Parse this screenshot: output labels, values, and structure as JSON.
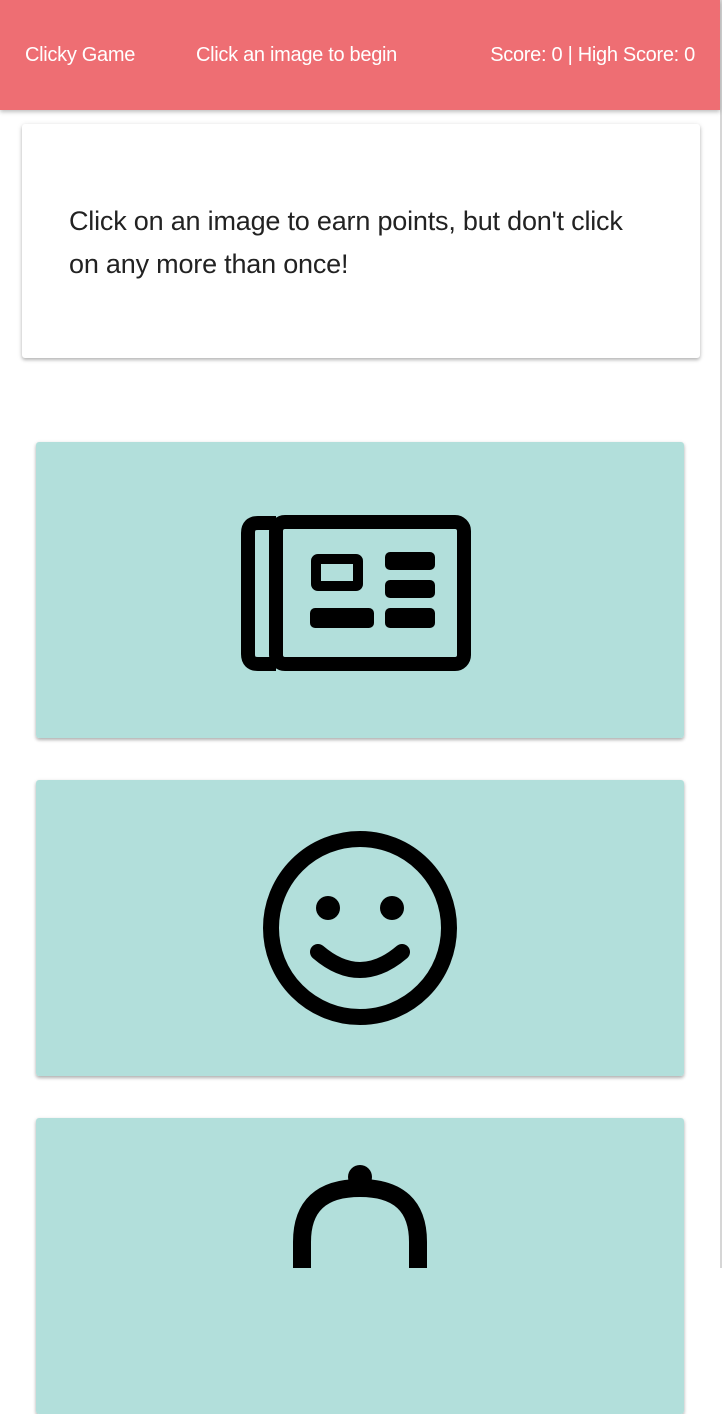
{
  "navbar": {
    "brand": "Clicky Game",
    "status": "Click an image to begin",
    "score": "Score: 0 | High Score: 0"
  },
  "intro": {
    "text": "Click on an image to earn points, but don't click on any more than once!"
  },
  "colors": {
    "navbar": "#ee6e73",
    "tile": "#b2dfdb",
    "icon": "#000000"
  },
  "tiles": [
    {
      "icon": "newspaper-icon"
    },
    {
      "icon": "smiley-face-icon"
    },
    {
      "icon": "bell-icon"
    }
  ]
}
